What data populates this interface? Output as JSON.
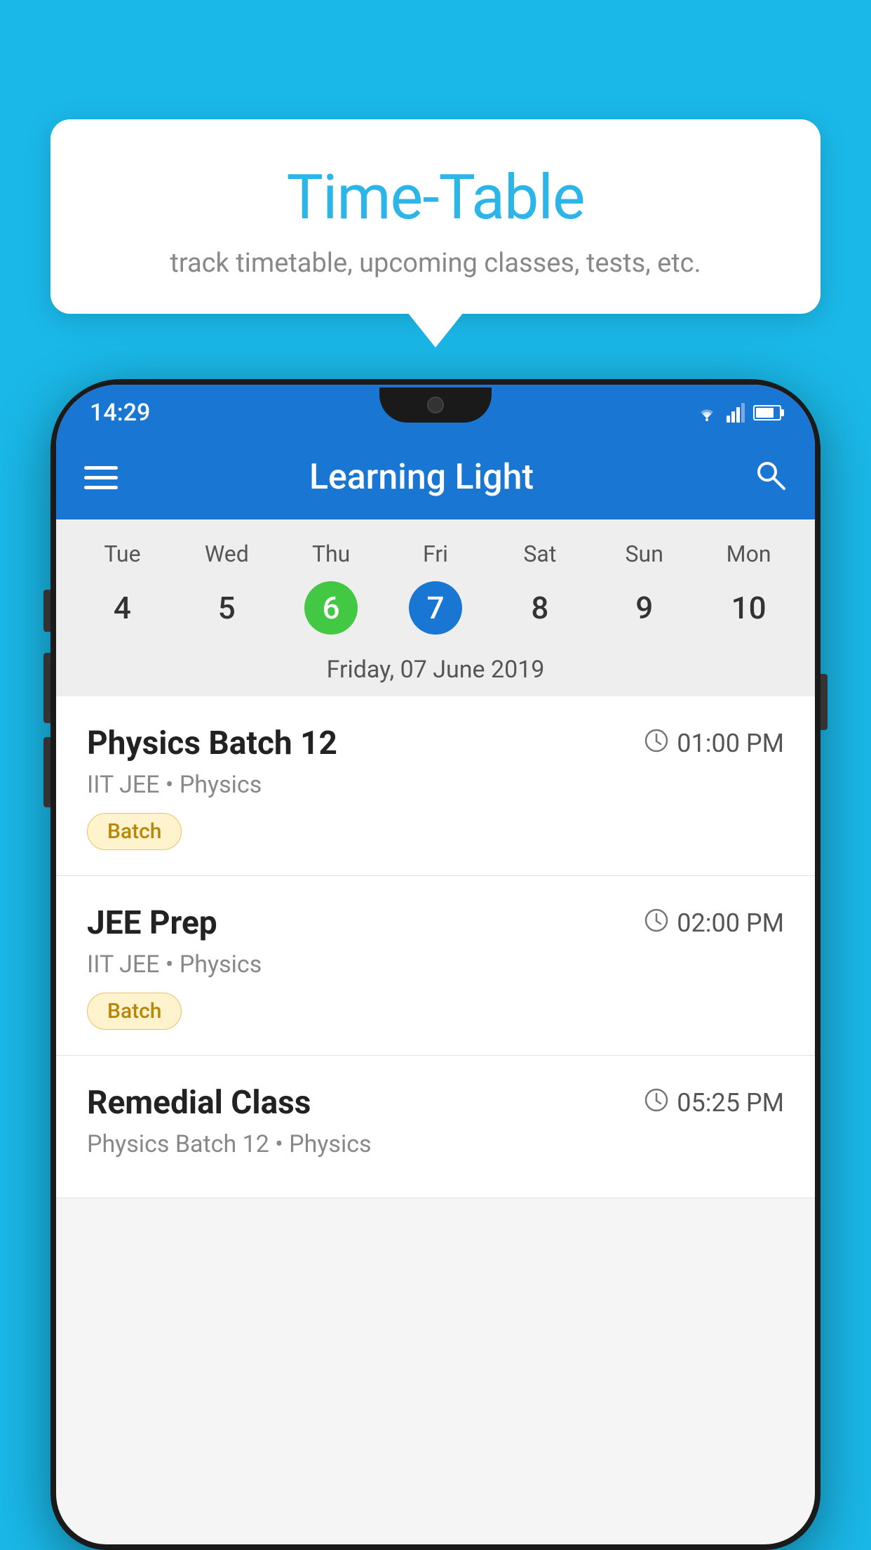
{
  "background_color": "#1ab8e8",
  "tooltip": {
    "title": "Time-Table",
    "subtitle": "track timetable, upcoming classes, tests, etc."
  },
  "phone": {
    "status_bar": {
      "time": "14:29"
    },
    "app_bar": {
      "title": "Learning Light"
    },
    "calendar": {
      "days": [
        "Tue",
        "Wed",
        "Thu",
        "Fri",
        "Sat",
        "Sun",
        "Mon"
      ],
      "dates": [
        "4",
        "5",
        "6",
        "7",
        "8",
        "9",
        "10"
      ],
      "today_index": 2,
      "selected_index": 3,
      "selected_label": "Friday, 07 June 2019"
    },
    "schedule": [
      {
        "title": "Physics Batch 12",
        "time": "01:00 PM",
        "subtitle": "IIT JEE • Physics",
        "badge": "Batch"
      },
      {
        "title": "JEE Prep",
        "time": "02:00 PM",
        "subtitle": "IIT JEE • Physics",
        "badge": "Batch"
      },
      {
        "title": "Remedial Class",
        "time": "05:25 PM",
        "subtitle": "Physics Batch 12 • Physics",
        "badge": ""
      }
    ]
  }
}
